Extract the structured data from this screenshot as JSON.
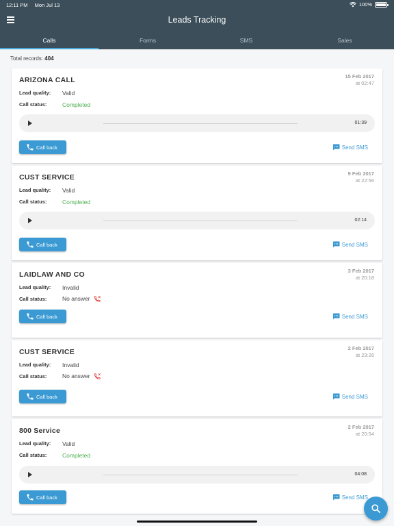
{
  "status_bar": {
    "time": "12:11 PM",
    "date": "Mon Jul 13",
    "battery": "100%"
  },
  "header": {
    "title": "Leads Tracking"
  },
  "tabs": [
    {
      "label": "Calls",
      "active": true
    },
    {
      "label": "Forms",
      "active": false
    },
    {
      "label": "SMS",
      "active": false
    },
    {
      "label": "Sales",
      "active": false
    }
  ],
  "summary": {
    "label": "Total records:",
    "count": "404"
  },
  "field_labels": {
    "lead_quality": "Lead quality:",
    "call_status": "Call status:"
  },
  "actions": {
    "call_back": "Call back",
    "send_sms": "Send SMS"
  },
  "records": [
    {
      "name": "ARIZONA CALL",
      "date": "15 Feb 2017",
      "time": "at 02:47",
      "lead_quality": "Valid",
      "call_status": "Completed",
      "duration": "01:39"
    },
    {
      "name": "CUST SERVICE",
      "date": "9 Feb 2017",
      "time": "at 22:56",
      "lead_quality": "Valid",
      "call_status": "Completed",
      "duration": "02:14"
    },
    {
      "name": "LAIDLAW AND CO",
      "date": "3 Feb 2017",
      "time": "at 20:18",
      "lead_quality": "Invalid",
      "call_status": "No answer"
    },
    {
      "name": "CUST SERVICE",
      "date": "2 Feb 2017",
      "time": "at 23:26",
      "lead_quality": "Invalid",
      "call_status": "No answer"
    },
    {
      "name": "800 Service",
      "date": "2 Feb 2017",
      "time": "at 20:54",
      "lead_quality": "Valid",
      "call_status": "Completed",
      "duration": "04:08"
    }
  ],
  "colors": {
    "app_bar": "#3b4e5a",
    "accent": "#3b9ad3",
    "completed": "#4caf50",
    "missed": "#e53935"
  }
}
